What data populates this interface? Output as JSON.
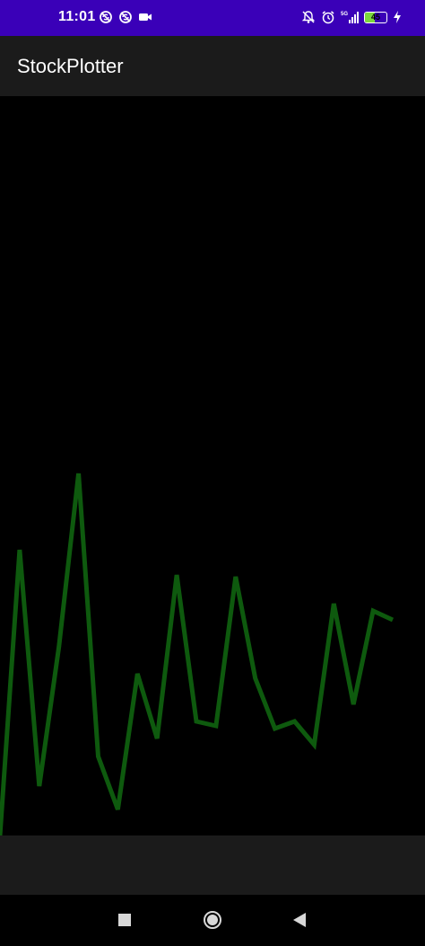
{
  "status_bar": {
    "time": "11:01",
    "battery_percent": "45",
    "battery_level": 0.45,
    "icons_left": [
      "sync-off-icon",
      "sync-off-icon",
      "video-camera-icon"
    ],
    "icons_right": [
      "notifications-off-icon",
      "alarm-icon",
      "5g-signal-icon",
      "battery-icon",
      "charging-icon"
    ],
    "background_color": "#3a00b8"
  },
  "app_bar": {
    "title": "StockPlotter",
    "background_color": "#1b1b1b"
  },
  "chart_data": {
    "type": "line",
    "line_color": "#0e5a0e",
    "background_color": "#000000",
    "grid": false,
    "axes_visible": false,
    "x": [
      0,
      1,
      2,
      3,
      4,
      5,
      6,
      7,
      8,
      9,
      10,
      11,
      12,
      13,
      14,
      15,
      16,
      17,
      18,
      19,
      20
    ],
    "values": [
      0,
      318,
      55,
      210,
      403,
      88,
      29,
      180,
      108,
      290,
      127,
      122,
      288,
      175,
      119,
      127,
      101,
      258,
      146,
      250,
      240
    ],
    "series": [
      {
        "values": [
          0,
          318,
          55,
          210,
          403,
          88,
          29,
          180,
          108,
          290,
          127,
          122,
          288,
          175,
          119,
          127,
          101,
          258,
          146,
          250,
          240
        ]
      }
    ]
  },
  "nav_bar": {
    "buttons": [
      "recents-square-icon",
      "home-circle-icon",
      "back-triangle-icon"
    ]
  }
}
